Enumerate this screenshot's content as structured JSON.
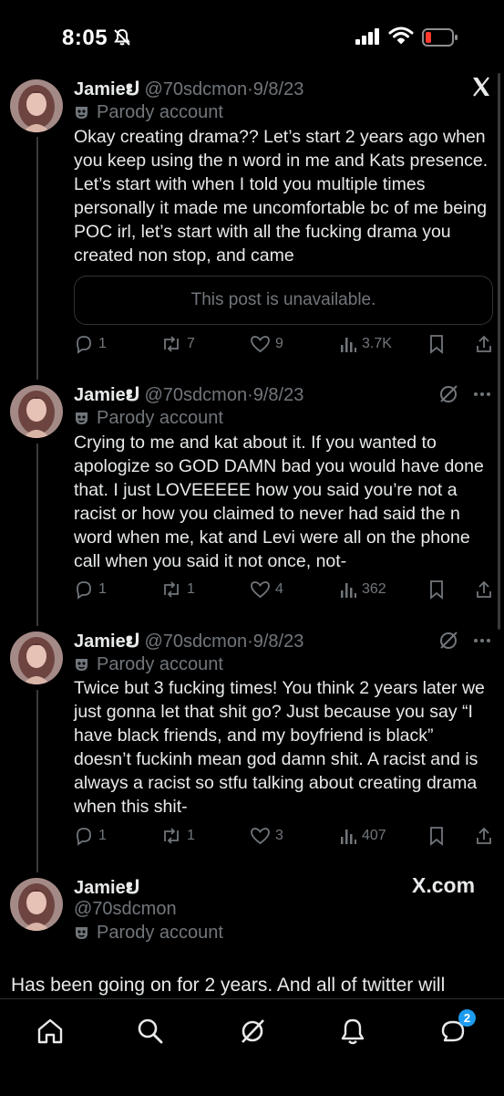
{
  "status_bar": {
    "time": "8:05"
  },
  "tweets": [
    {
      "name": "Jamieຢ",
      "handle": "@70sdcmon",
      "date": "9/8/23",
      "parody": "Parody account",
      "text": "Okay creating drama?? Let’s start 2 years ago when you keep using the n word in me and Kats presence. Let’s start with when I told you multiple times personally it made me uncomfortable bc of me being POC irl, let’s start with all the fucking drama you created non stop, and came",
      "quote": "This post is unavailable.",
      "replies": "1",
      "reposts": "7",
      "likes": "9",
      "views": "3.7K"
    },
    {
      "name": "Jamieຢ",
      "handle": "@70sdcmon",
      "date": "9/8/23",
      "parody": "Parody account",
      "text": "Crying to me and kat about it. If you wanted to apologize so GOD DAMN bad you would have done that. I just LOVEEEEE how you said you’re not a racist or how you claimed to never had said the n word when me, kat and Levi were all on the phone call when you said it not once, not-",
      "replies": "1",
      "reposts": "1",
      "likes": "4",
      "views": "362"
    },
    {
      "name": "Jamieຢ",
      "handle": "@70sdcmon",
      "date": "9/8/23",
      "parody": "Parody account",
      "text": "Twice but 3 fucking times! You think 2 years later we just gonna let that shit go? Just because you say “I have black friends, and my boyfriend is black” doesn’t fuckinh mean god damn shit. A racist and is always a racist so stfu talking about creating drama when this shit-",
      "replies": "1",
      "reposts": "1",
      "likes": "3",
      "views": "407"
    },
    {
      "name": "Jamieຢ",
      "handle": "@70sdcmon",
      "parody": "Parody account",
      "text": "Has been going on for 2 years. And all of twitter will"
    }
  ],
  "brand": "X.com",
  "nav": {
    "messages_badge": "2"
  },
  "colors": {
    "background": "#000000",
    "text": "#e7e9ea",
    "muted": "#71767b",
    "accent": "#1d9bf0",
    "battery_low": "#ff3b30"
  },
  "icons": [
    "bell-slash-icon",
    "signal-icon",
    "wifi-icon",
    "battery-low-icon",
    "close-icon",
    "grok-icon",
    "more-icon",
    "mask-icon",
    "reply-icon",
    "repost-icon",
    "like-icon",
    "views-icon",
    "bookmark-icon",
    "share-icon",
    "home-icon",
    "search-icon",
    "notifications-icon",
    "messages-icon"
  ]
}
